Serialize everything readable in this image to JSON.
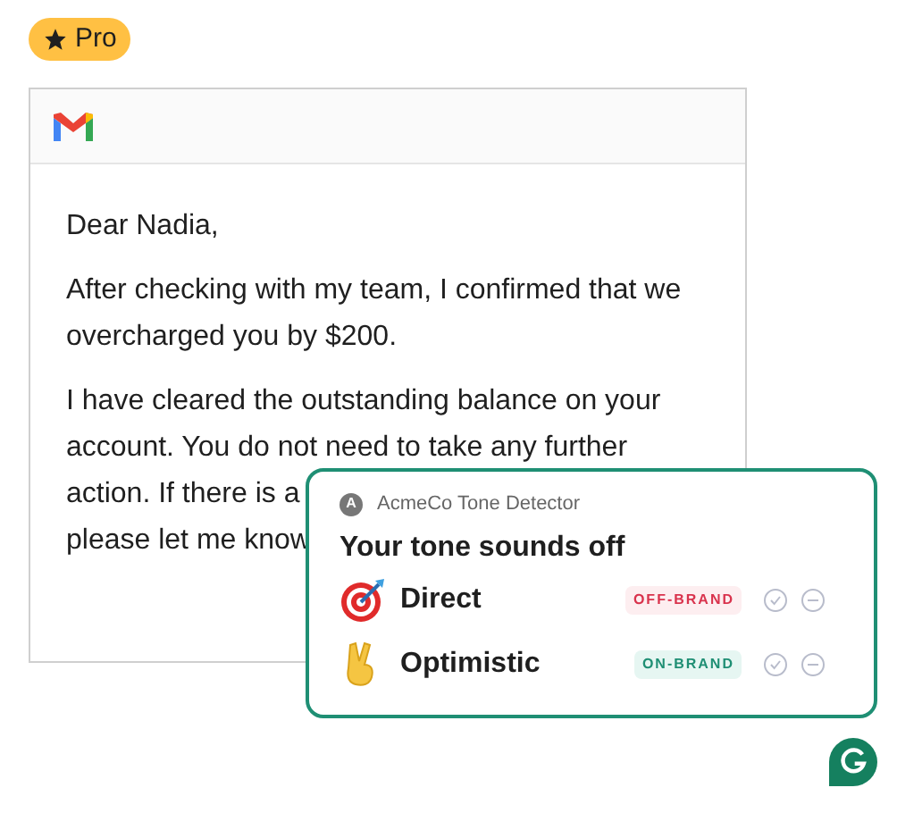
{
  "badge": {
    "label": "Pro"
  },
  "email": {
    "greeting": "Dear Nadia,",
    "paragraphs": [
      {
        "lines": [
          "After checking with my team, I confirmed that we",
          "overcharged you by $200."
        ]
      },
      {
        "lines": [
          "I have cleared the outstanding balance on your",
          "account. You do not need to take any further",
          "action. If there is a",
          "please let me know"
        ]
      }
    ]
  },
  "tone_card": {
    "app_initial": "A",
    "app_name": "AcmeCo Tone Detector",
    "title": "Your tone sounds off",
    "tones": [
      {
        "label": "Direct",
        "tag": "OFF-BRAND",
        "kind": "off"
      },
      {
        "label": "Optimistic",
        "tag": "ON-BRAND",
        "kind": "on"
      }
    ]
  }
}
